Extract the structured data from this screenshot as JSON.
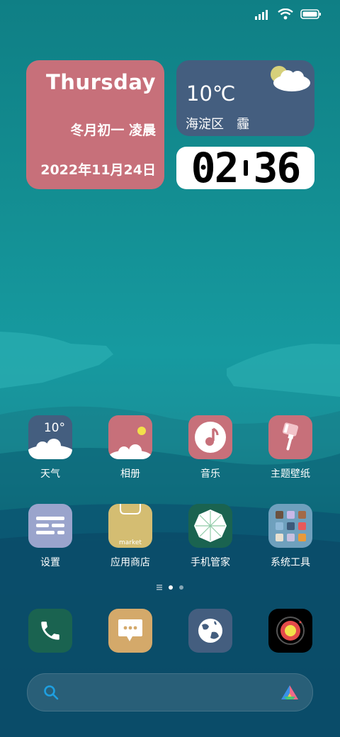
{
  "status_bar": {
    "icons": [
      "signal-icon",
      "wifi-icon",
      "battery-icon"
    ]
  },
  "date_widget": {
    "day": "Thursday",
    "lunar": "冬月初一 凌晨",
    "date": "2022年11月24日"
  },
  "weather_widget": {
    "temperature": "10℃",
    "location": "海淀区",
    "condition": "霾"
  },
  "clock_widget": {
    "hours": "02",
    "minutes": "36"
  },
  "weather_icon_temp": "10°",
  "apps": [
    {
      "label": "天气",
      "icon": "weather-icon"
    },
    {
      "label": "相册",
      "icon": "gallery-icon"
    },
    {
      "label": "音乐",
      "icon": "music-icon"
    },
    {
      "label": "主题壁纸",
      "icon": "theme-icon"
    },
    {
      "label": "设置",
      "icon": "settings-icon"
    },
    {
      "label": "应用商店",
      "icon": "app-store-icon"
    },
    {
      "label": "手机管家",
      "icon": "security-icon"
    },
    {
      "label": "系统工具",
      "icon": "tools-folder-icon"
    }
  ],
  "market_label": "market",
  "dock": [
    "phone-icon",
    "messages-icon",
    "browser-icon",
    "camera-icon"
  ],
  "page_indicator": {
    "pages": 2,
    "current": 1
  },
  "colors": {
    "widget_pink": "#c7707a",
    "widget_blue": "#445e7f"
  }
}
